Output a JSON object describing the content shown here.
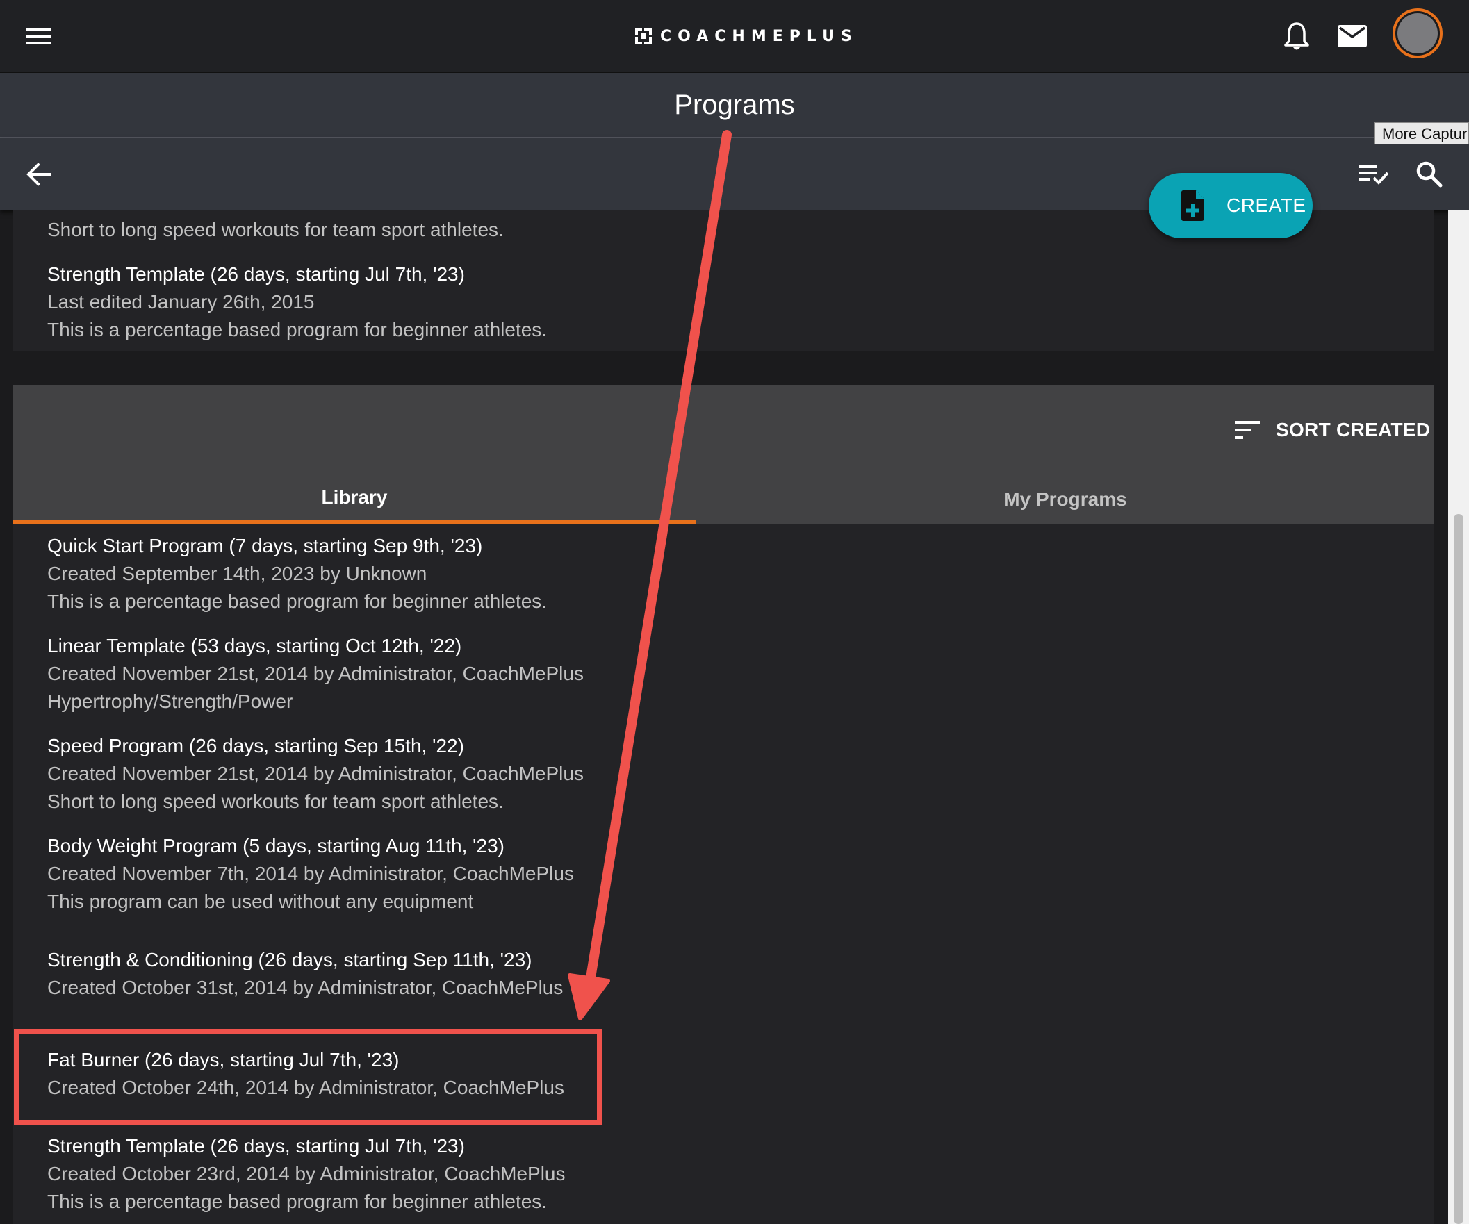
{
  "header": {
    "brand": "COACHMEPLUS",
    "page_title": "Programs",
    "tooltip": "More Captur"
  },
  "toolbar": {
    "create_label": "CREATE"
  },
  "top_list": {
    "partial_description": "Short to long speed workouts for team sport athletes.",
    "item": {
      "title": "Strength Template (26 days, starting Jul 7th, '23)",
      "meta": "Last edited January 26th, 2015",
      "description": "This is a percentage based program for beginner athletes."
    }
  },
  "library": {
    "sort_label": "SORT CREATED",
    "tabs": [
      {
        "label": "Library",
        "active": true
      },
      {
        "label": "My Programs",
        "active": false
      }
    ],
    "items": [
      {
        "title": "Quick Start Program (7 days, starting Sep 9th, '23)",
        "meta": "Created September 14th, 2023 by Unknown",
        "description": "This is a percentage based program for beginner athletes."
      },
      {
        "title": "Linear Template (53 days, starting Oct 12th, '22)",
        "meta": "Created November 21st, 2014 by Administrator, CoachMePlus",
        "description": "Hypertrophy/Strength/Power"
      },
      {
        "title": "Speed Program (26 days, starting Sep 15th, '22)",
        "meta": "Created November 21st, 2014 by Administrator, CoachMePlus",
        "description": "Short to long speed workouts for team sport athletes."
      },
      {
        "title": "Body Weight Program (5 days, starting Aug 11th, '23)",
        "meta": "Created November 7th, 2014 by Administrator, CoachMePlus",
        "description": "This program can be used without any equipment"
      },
      {
        "title": "Strength & Conditioning (26 days, starting Sep 11th, '23)",
        "meta": "Created October 31st, 2014 by Administrator, CoachMePlus",
        "description": ""
      },
      {
        "title": "Fat Burner (26 days, starting Jul 7th, '23)",
        "meta": "Created October 24th, 2014 by Administrator, CoachMePlus",
        "description": ""
      },
      {
        "title": "Strength Template (26 days, starting Jul 7th, '23)",
        "meta": "Created October 23rd, 2014 by Administrator, CoachMePlus",
        "description": "This is a percentage based program for beginner athletes."
      }
    ]
  },
  "colors": {
    "accent_orange": "#e8711b",
    "create_teal": "#0aa3b4",
    "annotation_red": "#f0524c"
  },
  "icons": [
    "menu-icon",
    "bell-icon",
    "mail-icon",
    "back-arrow-icon",
    "checklist-icon",
    "search-icon",
    "add-file-icon",
    "sort-icon"
  ]
}
